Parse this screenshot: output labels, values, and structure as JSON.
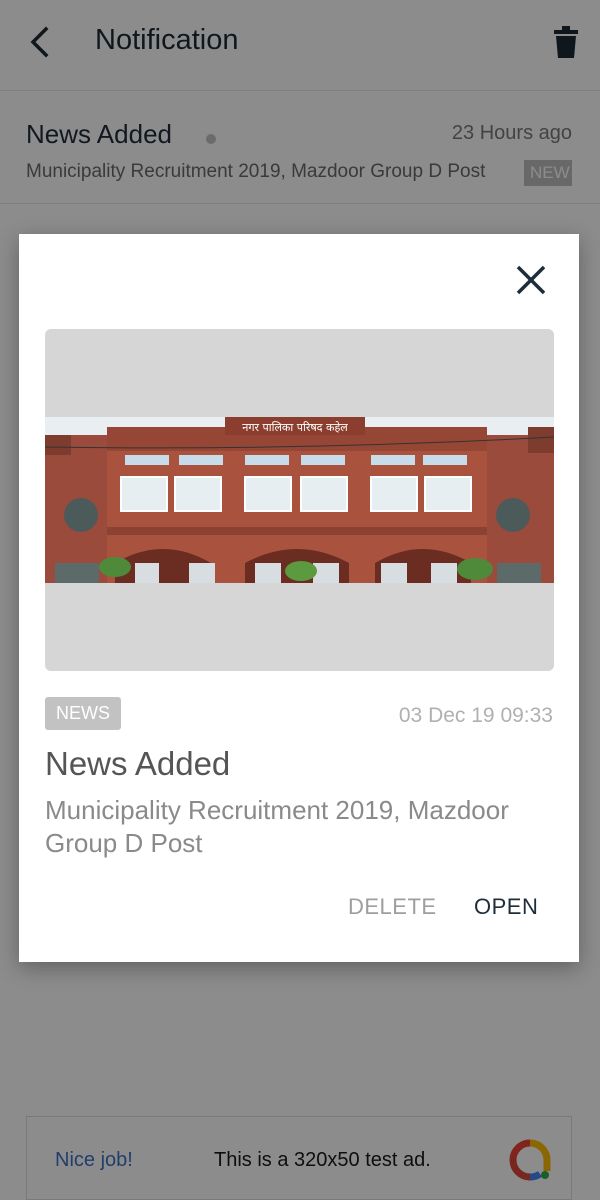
{
  "header": {
    "title": "Notification",
    "back_icon": "back-arrow-icon",
    "delete_icon": "trash-icon"
  },
  "notifications": [
    {
      "title": "News Added",
      "time": "23 Hours ago",
      "body": "Municipality Recruitment 2019, Mazdoor Group D Post",
      "badge": "NEW"
    }
  ],
  "dialog": {
    "close_icon": "close-icon",
    "image": {
      "signboard_text": "नगर पालिका परिषद कहेल"
    },
    "badge": "NEWS",
    "date": "03 Dec 19 09:33",
    "title": "News Added",
    "body": "Municipality Recruitment 2019, Mazdoor Group D Post",
    "delete_label": "DELETE",
    "open_label": "OPEN"
  },
  "ad": {
    "label": "Nice job!",
    "text": "This is a 320x50 test ad.",
    "logo_icon": "ads-logo-icon"
  },
  "colors": {
    "scrim": "#000000",
    "primary_text": "#1f2d3a",
    "badge_bg": "#c2c2c2",
    "ad_link": "#3d73c4"
  }
}
